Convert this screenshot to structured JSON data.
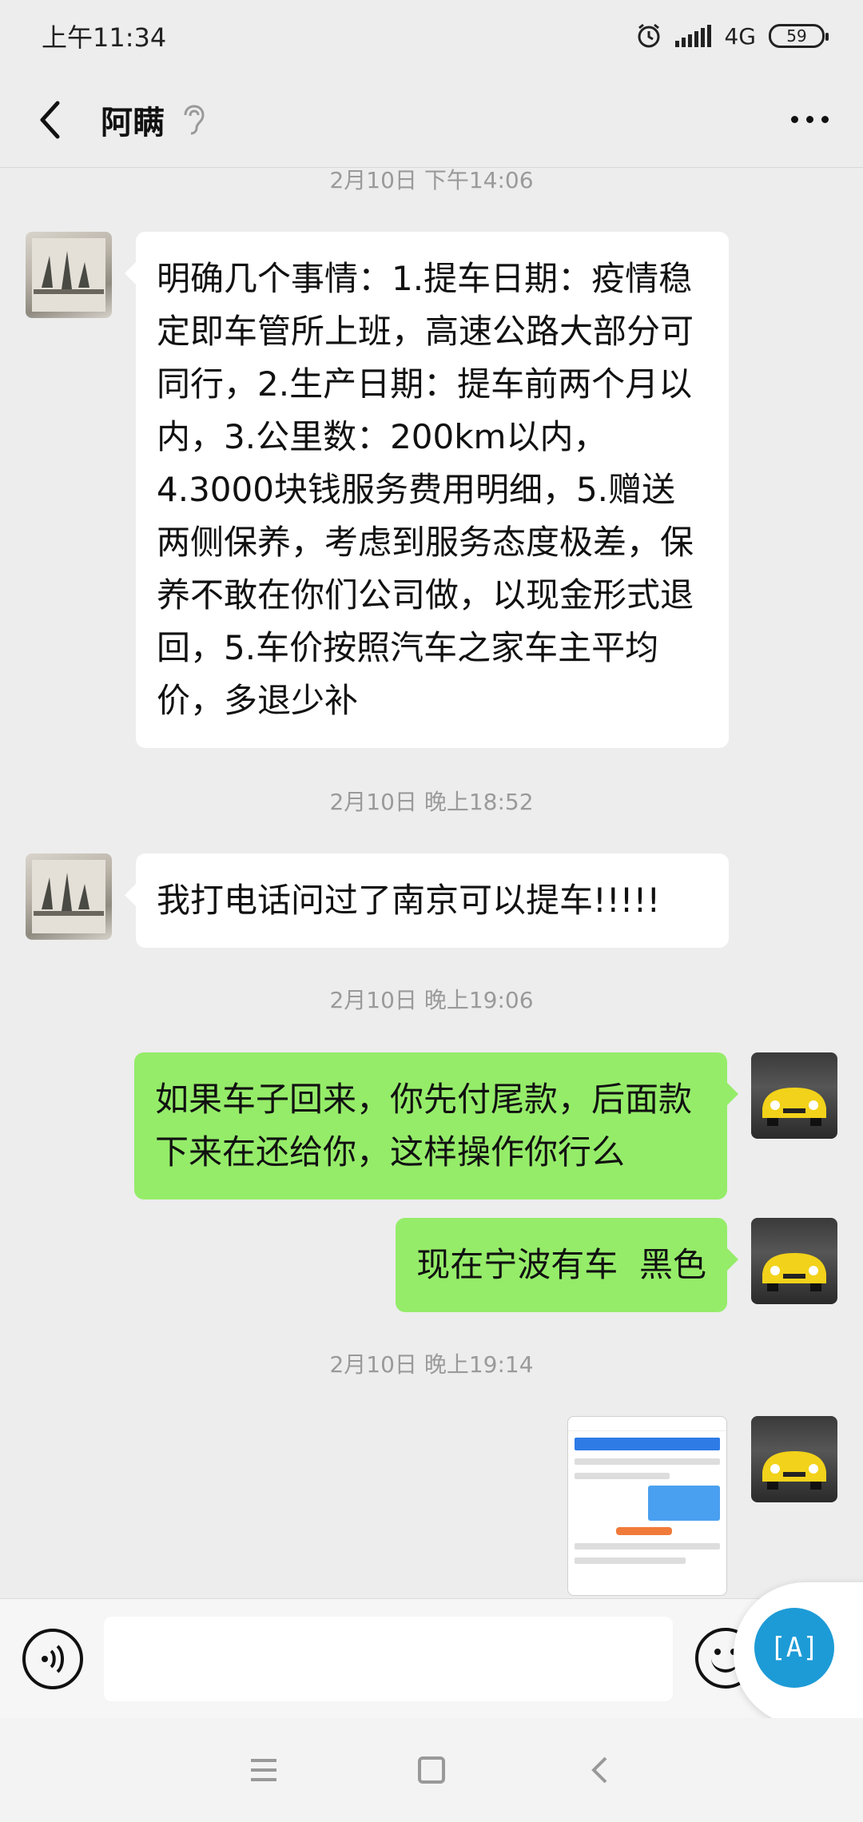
{
  "status_bar": {
    "time": "上午11:34",
    "network": "4G",
    "battery": "59"
  },
  "header": {
    "contact_name": "阿瞒"
  },
  "messages": [
    {
      "type": "timestamp",
      "text": "2月10日 下午14:06"
    },
    {
      "type": "text",
      "side": "left",
      "text": "明确几个事情：1.提车日期：疫情稳定即车管所上班，高速公路大部分可同行，2.生产日期：提车前两个月以内，3.公里数：200km以内，4.3000块钱服务费用明细，5.赠送两侧保养，考虑到服务态度极差，保养不敢在你们公司做，以现金形式退回，5.车价按照汽车之家车主平均价，多退少补"
    },
    {
      "type": "timestamp",
      "text": "2月10日 晚上18:52"
    },
    {
      "type": "text",
      "side": "left",
      "text": "我打电话问过了南京可以提车!!!!!"
    },
    {
      "type": "timestamp",
      "text": "2月10日 晚上19:06"
    },
    {
      "type": "text",
      "side": "right",
      "text": "如果车子回来，你先付尾款，后面款下来在还给你，这样操作你行么"
    },
    {
      "type": "text",
      "side": "right",
      "text": "现在宁波有车  黑色"
    },
    {
      "type": "timestamp",
      "text": "2月10日 晚上19:14"
    },
    {
      "type": "image",
      "side": "right"
    }
  ],
  "input_bar": {
    "value": "",
    "translate_label": "[A]"
  },
  "colors": {
    "background": "#ededed",
    "sent_bubble": "#95ec69",
    "received_bubble": "#ffffff",
    "translate_button": "#1d9bd6"
  },
  "icons": {
    "back": "chevron-left-icon",
    "ear": "ear-icon",
    "more": "more-dots-icon",
    "voice": "voice-icon",
    "emoji": "emoji-icon",
    "alarm": "alarm-icon",
    "signal": "signal-icon"
  }
}
